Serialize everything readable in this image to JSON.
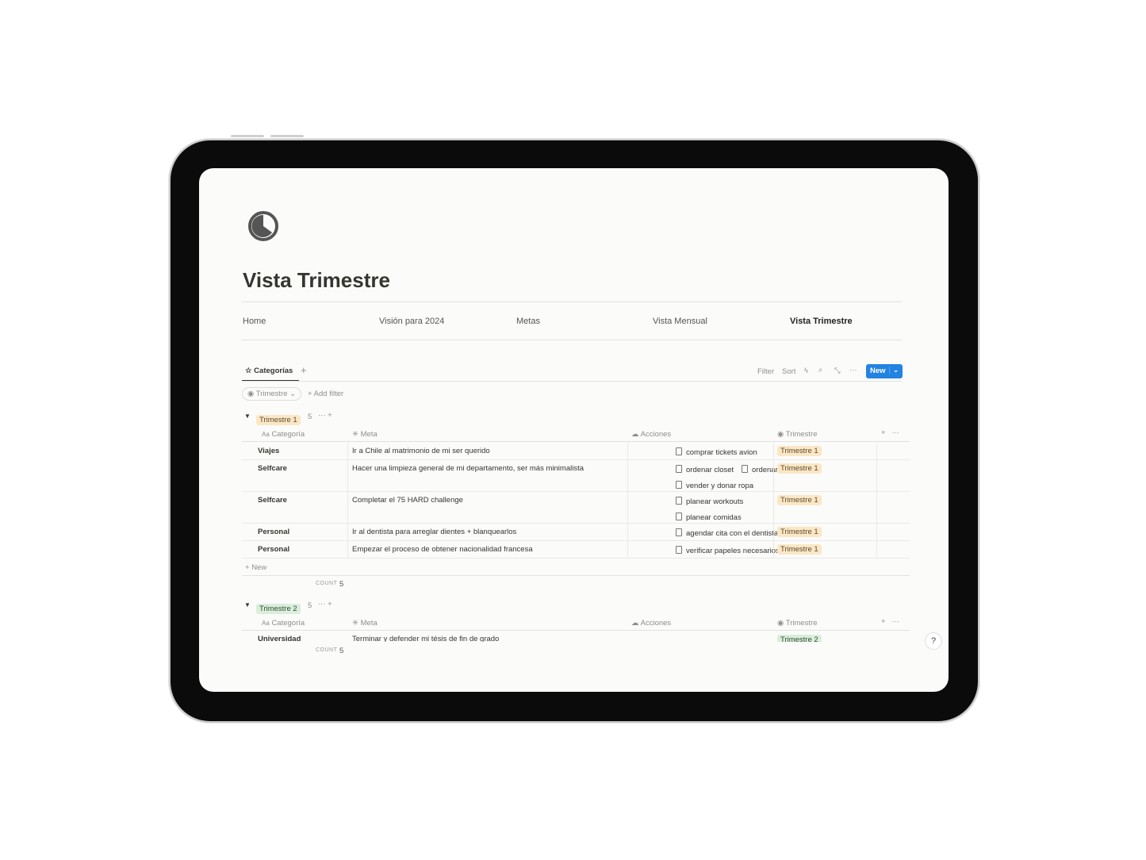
{
  "page": {
    "title": "Vista Trimestre",
    "icon": "pie-chart-icon"
  },
  "nav": [
    "Home",
    "Visión para 2024",
    "Metas",
    "Vista Mensual",
    "Vista Trimestre"
  ],
  "view": {
    "tab": "Categorías",
    "filter": "Filter",
    "sort": "Sort",
    "new": "New",
    "filter_chip": "Trimestre",
    "add_filter": "Add filter"
  },
  "columns": {
    "categoria": "Categoría",
    "meta": "Meta",
    "acciones": "Acciones",
    "trimestre": "Trimestre",
    "aa": "Aa"
  },
  "groups": [
    {
      "label": "Trimestre 1",
      "count": "5",
      "rows": [
        {
          "categoria": "Viajes",
          "meta": "Ir a Chile al matrimonio de mi ser querido",
          "acciones": [
            "comprar tickets avion"
          ],
          "trimestre": "Trimestre 1"
        },
        {
          "categoria": "Selfcare",
          "meta": "Hacer una limpieza general de mi departamento, ser más minimalista",
          "acciones": [
            "ordenar closet",
            "ordenar cocina",
            "vender y donar ropa"
          ],
          "trimestre": "Trimestre 1"
        },
        {
          "categoria": "Selfcare",
          "meta": "Completar el 75 HARD challenge",
          "acciones": [
            "planear workouts",
            "planear comidas"
          ],
          "trimestre": "Trimestre 1"
        },
        {
          "categoria": "Personal",
          "meta": "Ir al dentista para arreglar dientes + blanquearlos",
          "acciones": [
            "agendar cita con el dentista"
          ],
          "trimestre": "Trimestre 1"
        },
        {
          "categoria": "Personal",
          "meta": "Empezar el proceso de obtener nacionalidad francesa",
          "acciones": [
            "verificar papeles necesarios"
          ],
          "trimestre": "Trimestre 1"
        }
      ],
      "new": "New",
      "count_label": "COUNT",
      "count_value": "5"
    },
    {
      "label": "Trimestre 2",
      "count": "5",
      "rows": [
        {
          "categoria": "Universidad",
          "meta": "Terminar y defender mi tésis de fin de grado",
          "trimestre": "Trimestre 2"
        }
      ],
      "count_label": "COUNT",
      "count_value": "5"
    }
  ],
  "help": "?",
  "colors": {
    "accent": "#2383e2",
    "t1": "#fbe7c6",
    "t2": "#dbeddb"
  }
}
